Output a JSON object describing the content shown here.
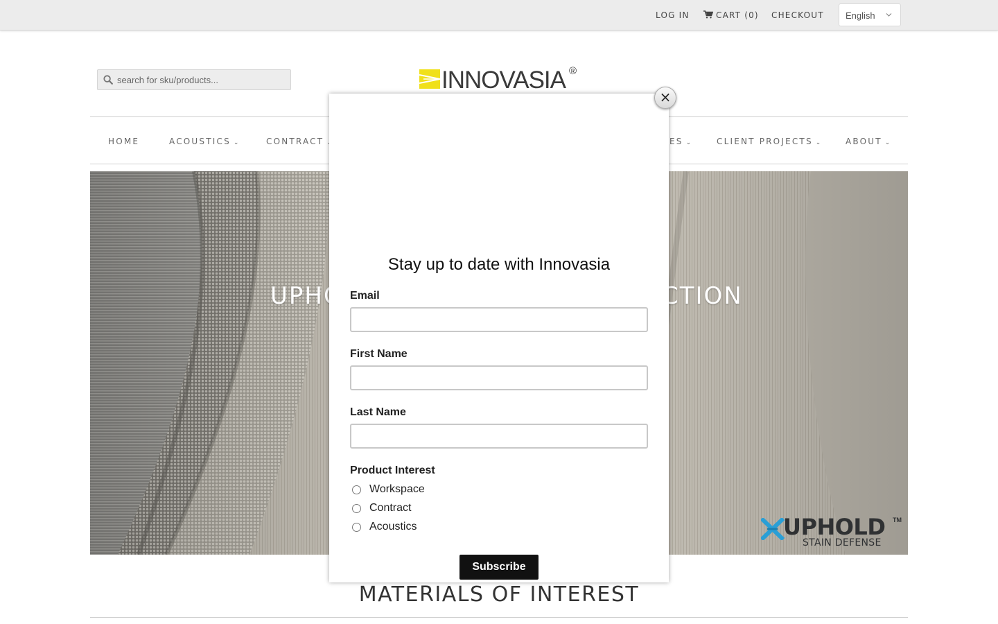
{
  "topbar": {
    "login": "LOG IN",
    "cart": "CART (0)",
    "checkout": "CHECKOUT",
    "language": "English"
  },
  "search": {
    "placeholder": "search for sku/products..."
  },
  "logo": {
    "wordmark": "INNOVASIA",
    "registered": "®",
    "accent_color": "#f0e01a"
  },
  "nav": {
    "items": [
      {
        "label": "HOME"
      },
      {
        "label": "ACOUSTICS",
        "caret": "⌄"
      },
      {
        "label": "CONTRACT",
        "caret": "⌄"
      },
      {
        "label": "ES",
        "caret": "⌄"
      },
      {
        "label": "CLIENT PROJECTS",
        "caret": "⌄"
      },
      {
        "label": "ABOUT",
        "caret": "⌄"
      }
    ]
  },
  "hero": {
    "title_left": "UPHO",
    "title_right": "CTION",
    "badge": {
      "word": "UPHOLD",
      "tm": "TM",
      "sub": "STAIN DEFENSE",
      "mark_color": "#2a9fd6"
    }
  },
  "section": {
    "title": "MATERIALS OF INTEREST"
  },
  "modal": {
    "close": "×",
    "heading": "Stay up to date with Innovasia",
    "email_label": "Email",
    "first_name_label": "First Name",
    "last_name_label": "Last Name",
    "interest_label": "Product Interest",
    "options": [
      "Workspace",
      "Contract",
      "Acoustics"
    ],
    "subscribe": "Subscribe"
  }
}
